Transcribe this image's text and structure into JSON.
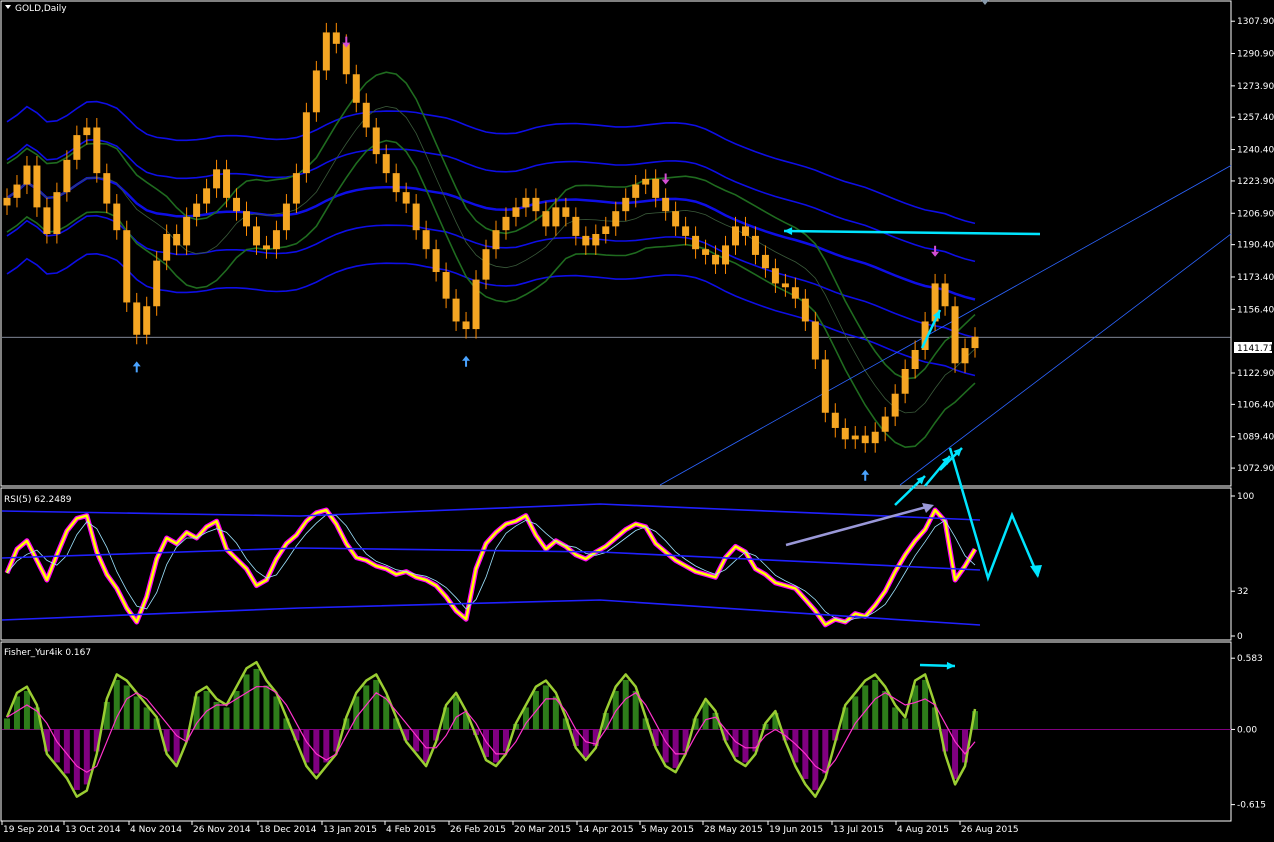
{
  "window": {
    "title": "GOLD,Daily",
    "scroll_marker": "triangle-down-icon"
  },
  "colors": {
    "background": "#000000",
    "frame": "#ffffff",
    "candle_body": "#f5a623",
    "candle_wick": "#ff8c00",
    "bands_blue": "#1010ff",
    "bands_green": "#1f6b1f",
    "rsi_line": "#ffff00",
    "rsi_glow": "#ff00ff",
    "fisher_line": "#9acd32",
    "fisher_signal": "#ff33cc",
    "hist_pos": "#2e7d1a",
    "hist_neg": "#800080",
    "annotation": "#00e5ff"
  },
  "chart_data": [
    {
      "type": "candlestick",
      "title": "GOLD,Daily",
      "ylim": [
        1064,
        1318
      ],
      "y_ticks": [
        "1307.90",
        "1290.90",
        "1273.90",
        "1257.40",
        "1240.40",
        "1223.90",
        "1206.90",
        "1190.40",
        "1173.40",
        "1156.40",
        "1141.71",
        "1122.90",
        "1106.40",
        "1089.40",
        "1072.90"
      ],
      "current_price": "1141.71",
      "x_labels": [
        "19 Sep 2014",
        "13 Oct 2014",
        "4 Nov 2014",
        "26 Nov 2014",
        "18 Dec 2014",
        "13 Jan 2015",
        "4 Feb 2015",
        "26 Feb 2015",
        "20 Mar 2015",
        "14 Apr 2015",
        "5 May 2015",
        "28 May 2015",
        "19 Jun 2015",
        "13 Jul 2015",
        "4 Aug 2015",
        "26 Aug 2015"
      ],
      "close_path": [
        1215,
        1222,
        1232,
        1210,
        1196,
        1218,
        1235,
        1248,
        1252,
        1228,
        1212,
        1198,
        1160,
        1143,
        1158,
        1182,
        1196,
        1190,
        1205,
        1212,
        1220,
        1230,
        1215,
        1208,
        1200,
        1190,
        1188,
        1198,
        1212,
        1228,
        1260,
        1282,
        1302,
        1296,
        1280,
        1265,
        1252,
        1238,
        1228,
        1218,
        1212,
        1198,
        1188,
        1176,
        1162,
        1150,
        1146,
        1172,
        1188,
        1198,
        1205,
        1210,
        1215,
        1208,
        1200,
        1210,
        1205,
        1195,
        1190,
        1196,
        1200,
        1208,
        1215,
        1222,
        1225,
        1215,
        1208,
        1200,
        1195,
        1188,
        1185,
        1180,
        1190,
        1200,
        1195,
        1185,
        1178,
        1170,
        1168,
        1162,
        1150,
        1130,
        1102,
        1094,
        1088,
        1090,
        1086,
        1092,
        1100,
        1112,
        1125,
        1135,
        1150,
        1170,
        1158,
        1128,
        1136,
        1142
      ],
      "annotations": [
        "arrow-up-icon",
        "arrow-down-icon",
        "arrow-up-icon",
        "arrow-down-icon",
        "arrow-up-icon",
        "arrow-down-icon"
      ]
    },
    {
      "type": "line",
      "title": "RSI(5) 62.2489",
      "ylim": [
        0,
        100
      ],
      "y_ticks": [
        "100",
        "32",
        "0"
      ],
      "values": [
        45,
        62,
        68,
        54,
        40,
        58,
        75,
        84,
        86,
        60,
        44,
        34,
        20,
        10,
        28,
        55,
        70,
        66,
        74,
        70,
        78,
        82,
        62,
        55,
        48,
        36,
        40,
        55,
        66,
        72,
        82,
        88,
        90,
        80,
        66,
        56,
        54,
        50,
        48,
        44,
        46,
        42,
        40,
        36,
        28,
        18,
        12,
        48,
        66,
        74,
        80,
        82,
        86,
        72,
        62,
        68,
        64,
        58,
        55,
        60,
        64,
        70,
        76,
        80,
        78,
        66,
        60,
        54,
        50,
        46,
        44,
        42,
        56,
        64,
        60,
        48,
        44,
        38,
        36,
        34,
        26,
        18,
        8,
        12,
        10,
        16,
        14,
        22,
        32,
        46,
        58,
        68,
        76,
        90,
        82,
        40,
        50,
        62
      ]
    },
    {
      "type": "bar",
      "title": "Fisher_Yur4ik 0.167",
      "ylim": [
        -0.7,
        0.65
      ],
      "y_ticks": [
        "0.583",
        "0.00",
        "-0.615"
      ],
      "values": [
        0.1,
        0.3,
        0.35,
        0.2,
        -0.2,
        -0.3,
        -0.4,
        -0.55,
        -0.5,
        -0.2,
        0.25,
        0.45,
        0.4,
        0.3,
        0.2,
        0.1,
        -0.2,
        -0.3,
        -0.1,
        0.3,
        0.35,
        0.25,
        0.2,
        0.35,
        0.5,
        0.55,
        0.4,
        0.3,
        0.1,
        -0.1,
        -0.3,
        -0.4,
        -0.3,
        -0.2,
        0.1,
        0.3,
        0.4,
        0.45,
        0.3,
        0.1,
        -0.1,
        -0.2,
        -0.3,
        -0.1,
        0.2,
        0.3,
        0.15,
        -0.05,
        -0.25,
        -0.3,
        -0.2,
        0.05,
        0.2,
        0.35,
        0.4,
        0.3,
        0.1,
        -0.15,
        -0.25,
        -0.15,
        0.15,
        0.35,
        0.45,
        0.35,
        0.1,
        -0.15,
        -0.3,
        -0.35,
        -0.2,
        0.1,
        0.25,
        0.15,
        -0.1,
        -0.25,
        -0.3,
        -0.2,
        0.05,
        0.15,
        -0.1,
        -0.3,
        -0.45,
        -0.55,
        -0.4,
        -0.1,
        0.2,
        0.3,
        0.4,
        0.45,
        0.35,
        0.2,
        0.1,
        0.4,
        0.45,
        0.2,
        -0.2,
        -0.45,
        -0.3,
        0.167
      ],
      "signal": [
        0.1,
        0.15,
        0.2,
        0.15,
        0.05,
        -0.1,
        -0.2,
        -0.3,
        -0.35,
        -0.3,
        -0.1,
        0.1,
        0.25,
        0.3,
        0.25,
        0.15,
        0.05,
        -0.05,
        -0.1,
        0.05,
        0.15,
        0.2,
        0.2,
        0.25,
        0.3,
        0.35,
        0.35,
        0.3,
        0.2,
        0.05,
        -0.1,
        -0.2,
        -0.25,
        -0.2,
        -0.05,
        0.1,
        0.2,
        0.3,
        0.25,
        0.15,
        0.05,
        -0.05,
        -0.15,
        -0.15,
        -0.05,
        0.1,
        0.15,
        0.05,
        -0.1,
        -0.2,
        -0.2,
        -0.1,
        0.05,
        0.15,
        0.25,
        0.25,
        0.15,
        0.0,
        -0.1,
        -0.12,
        0.0,
        0.15,
        0.25,
        0.3,
        0.2,
        0.05,
        -0.1,
        -0.2,
        -0.2,
        -0.05,
        0.08,
        0.1,
        0.0,
        -0.1,
        -0.15,
        -0.15,
        -0.05,
        0.0,
        -0.05,
        -0.12,
        -0.2,
        -0.3,
        -0.35,
        -0.25,
        -0.1,
        0.05,
        0.15,
        0.25,
        0.3,
        0.25,
        0.2,
        0.22,
        0.25,
        0.2,
        0.05,
        -0.1,
        -0.2,
        -0.1
      ]
    }
  ]
}
